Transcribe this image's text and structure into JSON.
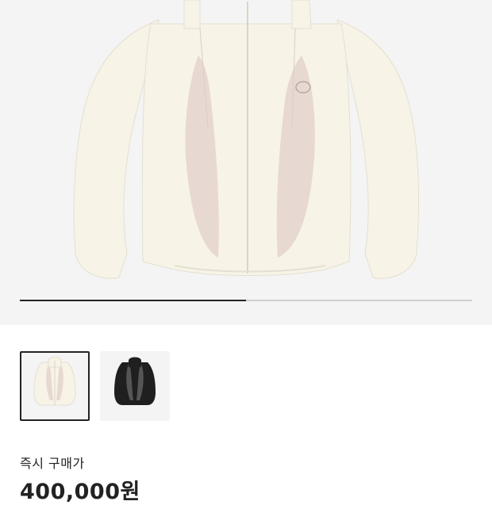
{
  "product": {
    "main_image_icon": "jacket-cream-pink",
    "image_progress_fraction": 0.5,
    "thumbnails": [
      {
        "icon": "jacket-cream-pink",
        "selected": true
      },
      {
        "icon": "jacket-black-gray",
        "selected": false
      }
    ],
    "price_label": "즉시 구매가",
    "price": "400,000원"
  },
  "colors": {
    "background": "#f4f4f4",
    "jacket_cream": "#f7f3e6",
    "jacket_pink": "#e8d8d2",
    "jacket_black": "#1f1f1f",
    "jacket_gray": "#555555",
    "text": "#222222"
  }
}
